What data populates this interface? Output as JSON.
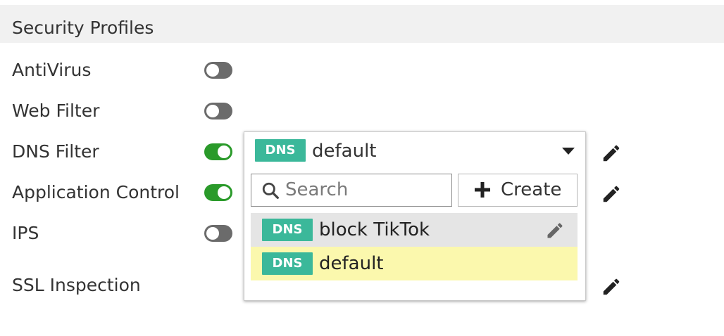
{
  "section": {
    "title": "Security Profiles"
  },
  "profiles": [
    {
      "label": "AntiVirus",
      "enabled": false
    },
    {
      "label": "Web Filter",
      "enabled": false
    },
    {
      "label": "DNS Filter",
      "enabled": true
    },
    {
      "label": "Application Control",
      "enabled": true
    },
    {
      "label": "IPS",
      "enabled": false
    },
    {
      "label": "SSL Inspection"
    }
  ],
  "dns_dropdown": {
    "badge": "DNS",
    "selected_value": "default",
    "search_placeholder": "Search",
    "create_label": "Create",
    "options": [
      {
        "badge": "DNS",
        "label": "block TikTok",
        "state": "hover"
      },
      {
        "badge": "DNS",
        "label": "default",
        "state": "selected"
      }
    ]
  },
  "colors": {
    "toggle_on": "#2a9a2a",
    "toggle_off": "#6b6b6b",
    "badge": "#3bb89a",
    "selected_highlight": "#fbf8ad",
    "hover_highlight": "#e5e5e5",
    "header_bg": "#f1f1f1"
  },
  "icons": {
    "edit": "pencil-icon",
    "search": "search-icon",
    "create": "plus-icon",
    "caret": "caret-down-icon"
  }
}
